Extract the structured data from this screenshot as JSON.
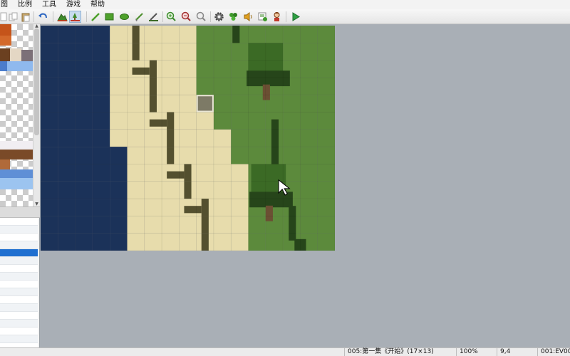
{
  "menu": [
    "图",
    "比例",
    "工具",
    "游戏",
    "帮助"
  ],
  "toolbar": {
    "icons": [
      "cut-icon",
      "copy-icon",
      "paste-icon",
      "undo-icon",
      "layer-lower-icon",
      "layer-upper-icon",
      "pencil-icon",
      "rectangle-icon",
      "ellipse-icon",
      "fill-icon",
      "select-icon",
      "zoom-in-icon",
      "zoom-out-icon",
      "zoom-actual-icon",
      "database-icon",
      "materials-icon",
      "sound-icon",
      "script-icon",
      "character-icon",
      "playtest-icon"
    ]
  },
  "map": {
    "cols": 17,
    "rows": 13,
    "tiles": [
      "WWWWSSSSSGGGGGGGG",
      "WWWWSSSSSGGGGGGGG",
      "WWWWSSSSSGGGGGGGG",
      "WWWWSSSSSGGGGGGGG",
      "WWWWSSSSSSGGGGGGG",
      "WWWWSSSSSSGGGGGGG",
      "WWWWSSSSSSSGGGGGG",
      "WWWWWSSSSSSGGGGGG",
      "WWWWWSSSSSSSGGGGG",
      "WWWWWSSSSSSSGGGGG",
      "WWWWWSSSSSSSGGGGG",
      "WWWWWSSSSSSSGGGGG",
      "WWWWWSSSSSSSGGGGG"
    ],
    "selected_cell": [
      9,
      4
    ],
    "colors": {
      "water": "#1b3259",
      "sand": "#e7dcac",
      "grass": "#5c8a3c",
      "path": "#54502f",
      "dark_grass": "#26451a",
      "tree": "#3b6a25",
      "trunk": "#6b4f33",
      "selected": "#7d7a66"
    }
  },
  "status": {
    "map_name": "005:第一集《开始》(17×13)",
    "zoom": "100%",
    "coords": "9,4",
    "event": "001:EV001"
  }
}
